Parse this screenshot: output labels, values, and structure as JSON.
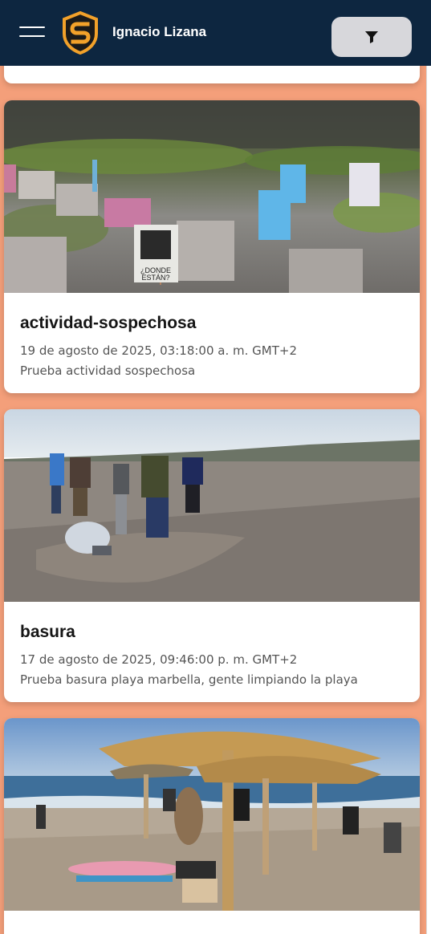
{
  "header": {
    "user_name": "Ignacio Lizana",
    "colors": {
      "background": "#0d2640",
      "logo_orange": "#f2a12a",
      "filter_button": "#d7d7db"
    },
    "icons": {
      "menu": "hamburger-menu-icon",
      "logo": "shield-s-logo",
      "filter": "funnel-filter-icon"
    }
  },
  "cards": [
    {
      "title": "actividad-sospechosa",
      "date": "19 de agosto de 2025, 03:18:00 a. m. GMT+2",
      "description": "Prueba actividad sospechosa",
      "image": "photo of beach dunes with blue ¿DONDE ESTÁN? posters on sticks"
    },
    {
      "title": "basura",
      "date": "17 de agosto de 2025, 09:46:00 p. m. GMT+2",
      "description": "Prueba basura playa marbella, gente limpiando la playa",
      "image": "photo of people cleaning a grey sandy beach"
    },
    {
      "image": "photo of sunny beach with thatched umbrellas and people"
    }
  ],
  "page_colors": {
    "background": "#f49f7a",
    "card": "#ffffff"
  }
}
